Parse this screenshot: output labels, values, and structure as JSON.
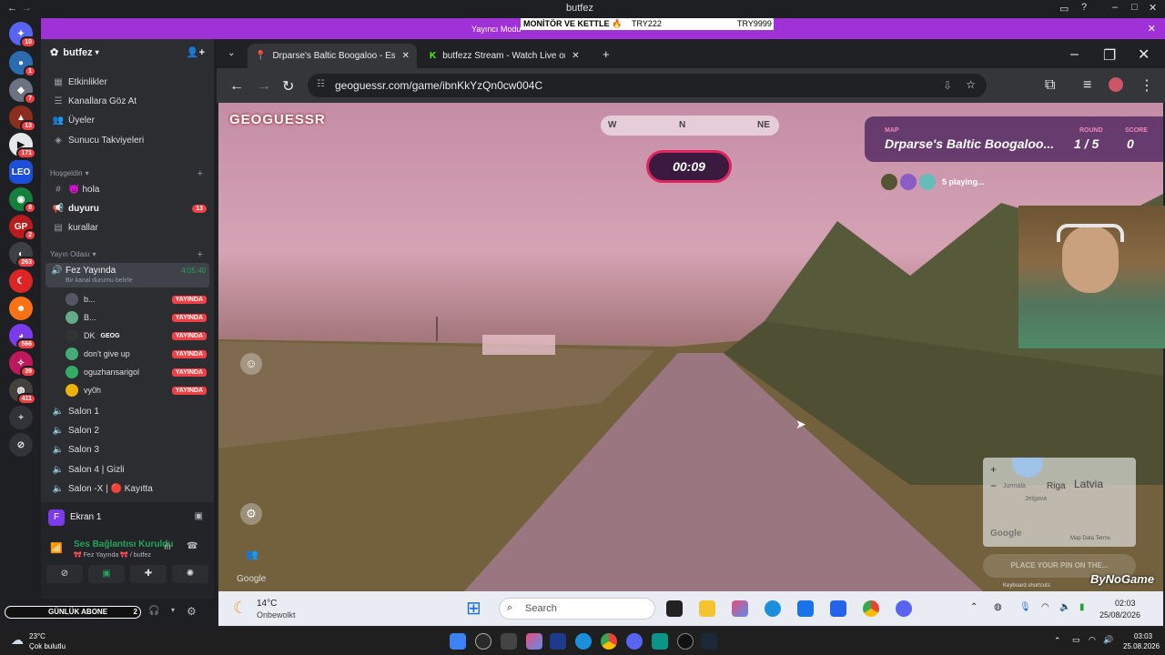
{
  "discord": {
    "window_title": "butfez",
    "banner_text": "Yayıncı Modu",
    "ticker": [
      "MONİTÖR VE KETTLE 🔥",
      "TRY222",
      "TRY9999"
    ],
    "server_name": "butfez",
    "server_badges": [
      "10",
      "1",
      "7",
      "13",
      "171",
      "8",
      "2",
      "263",
      "566",
      "39",
      "411"
    ],
    "menu_items": [
      "Etkinlikler",
      "Kanallara Göz At",
      "Üyeler",
      "Sunucu Takviyeleri"
    ],
    "category_1": "Hoşgeldin",
    "channels_1": [
      {
        "name": "hola",
        "badge": ""
      },
      {
        "name": "duyuru",
        "badge": "13"
      },
      {
        "name": "kurallar",
        "badge": ""
      }
    ],
    "category_2": "Yayın Odası",
    "voice_main": {
      "name": "Fez Yayında",
      "time": "4:05:40",
      "status": "Bir kanal durumu belirle"
    },
    "voice_users": [
      {
        "name": "b...",
        "tag": "YAYINDA"
      },
      {
        "name": "B...",
        "tag": "YAYINDA"
      },
      {
        "name": "DK",
        "tag": "YAYINDA",
        "extra": "GEOG"
      },
      {
        "name": "don't give up",
        "tag": "YAYINDA"
      },
      {
        "name": "oguzhansarigol",
        "tag": "YAYINDA"
      },
      {
        "name": "vy0h",
        "tag": "YAYINDA"
      }
    ],
    "salons": [
      "Salon 1",
      "Salon 2",
      "Salon 3",
      "Salon 4 | Gizli",
      "Salon -X | 🔴 Kayıtta"
    ],
    "screen_share": "Ekran 1",
    "voice_status": "Ses Bağlantısı Kuruldu",
    "voice_channel": "🎀 Fez Yayında 🎀 / butfez",
    "overlay_sub": "GÜNLÜK ABONE",
    "overlay_sub_count": "2"
  },
  "browser": {
    "tabs": [
      "Drparse's Baltic Boogaloo - Est",
      "butfezz Stream - Watch Live on"
    ],
    "url": "geoguessr.com/game/ibnKkYzQn0cw004C"
  },
  "game": {
    "logo": "GEOGUESSR",
    "compass": [
      "W",
      "N",
      "NE"
    ],
    "timer": "00:09",
    "map_label": "MAP",
    "map_name": "Drparse's Baltic Boogaloo...",
    "round_label": "ROUND",
    "round": "1 / 5",
    "score_label": "SCORE",
    "score": "0",
    "playing": "5 playing...",
    "minimap_country": "Latvia",
    "minimap_city": "Riga",
    "minimap_towns": [
      "Jurmala",
      "Jelgava"
    ],
    "minimap_brand": "Google",
    "minimap_footer": "Map Data  Terms",
    "place_pin": "PLACE YOUR PIN ON THE...",
    "google_watermark": "Google",
    "kbd_shortcuts": "Keyboard shortcuts",
    "bynogame": "ByNoGame"
  },
  "inner_taskbar": {
    "weather_temp": "14°C",
    "weather_desc": "Onbewolkt",
    "search_placeholder": "Search",
    "time": "02:03",
    "date": "25/08/2026"
  },
  "outer_taskbar": {
    "weather_temp": "23°C",
    "weather_desc": "Çok bulutlu",
    "time": "03:03",
    "date": "25.08.2026"
  },
  "colors": {
    "accent": "#a031d6",
    "live": "#f23f43",
    "online": "#23a55a",
    "game_accent": "#e0245e"
  }
}
